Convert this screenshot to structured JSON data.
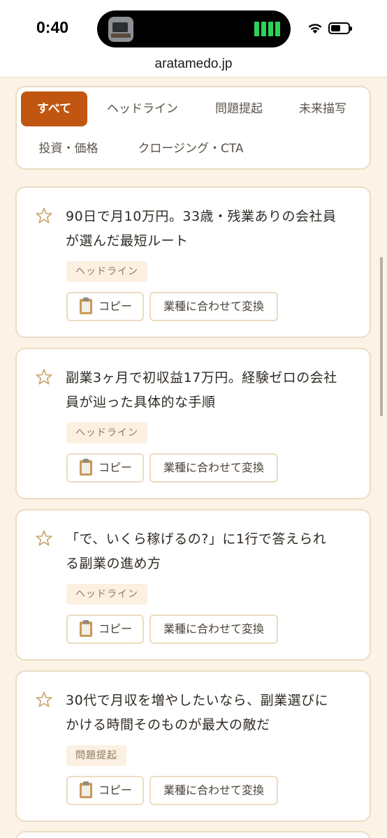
{
  "status": {
    "time": "0:40"
  },
  "browser": {
    "url": "aratamedo.jp"
  },
  "filters": [
    "すべて",
    "ヘッドライン",
    "問題提起",
    "未来描写",
    "投資・価格",
    "クロージング・CTA"
  ],
  "articles": [
    {
      "text": "90日で月10万円。33歳・残業ありの会社員が選んだ最短ルート",
      "line1": "90日で月10万円。33歳・残業ありの会社員",
      "line2": "が選んだ最短ルート",
      "tag": "ヘッドライン"
    },
    {
      "text": "副業3ヶ月で初収益17万円。経験ゼロの会社員が辿った具体的な手順",
      "line1": "副業3ヶ月で初収益17万円。経験ゼロの会社",
      "line2": "員が辿った具体的な手順",
      "tag": "ヘッドライン"
    },
    {
      "text": "「で、いくら稼げるの?」に1行で答えられる副業の進め方",
      "line1": "「で、いくら稼げるの?」に1行で答えられ",
      "line2": "る副業の進め方",
      "tag": "ヘッドライン"
    },
    {
      "text": "30代で月収を増やしたいなら、副業選びにかける時間そのものが最大の敵だ",
      "line1": "30代で月収を増やしたいなら、副業選びに",
      "line2": "かける時間そのものが最大の敵だ",
      "tag": "問題提起"
    }
  ],
  "actions": {
    "copy_label": "コピー",
    "convert_label": "業種に合わせて変換"
  },
  "colors": {
    "accent": "#c0560f",
    "background": "#fcf3e6",
    "border": "#ecdcc2",
    "star": "#c9a36a"
  }
}
